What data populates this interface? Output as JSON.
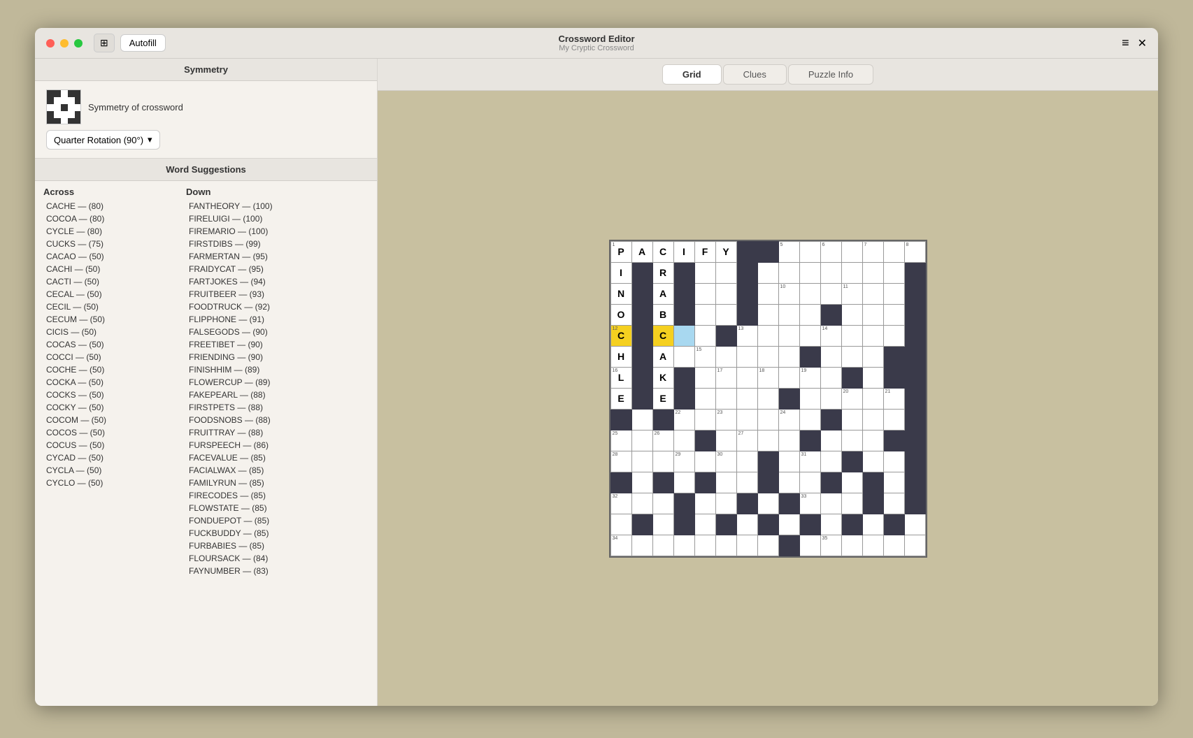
{
  "window": {
    "title": "Crossword Editor",
    "subtitle": "My Cryptic Crossword"
  },
  "titlebar": {
    "sidebar_icon": "⊞",
    "autofill_label": "Autofill",
    "menu_icon": "≡",
    "close_icon": "✕"
  },
  "tabs": [
    {
      "label": "Grid",
      "active": true
    },
    {
      "label": "Clues",
      "active": false
    },
    {
      "label": "Puzzle Info",
      "active": false
    }
  ],
  "sidebar": {
    "symmetry_section_label": "Symmetry",
    "symmetry_of_crossword_label": "Symmetry of crossword",
    "dropdown_label": "Quarter Rotation (90°)",
    "word_suggestions_label": "Word Suggestions",
    "across_label": "Across",
    "down_label": "Down",
    "across_items": [
      "CACHE — (80)",
      "COCOA — (80)",
      "CYCLE — (80)",
      "CUCKS — (75)",
      "CACAO — (50)",
      "CACHI — (50)",
      "CACTI — (50)",
      "CECAL — (50)",
      "CECIL — (50)",
      "CECUM — (50)",
      "CICIS — (50)",
      "COCAS — (50)",
      "COCCI — (50)",
      "COCHE — (50)",
      "COCKA — (50)",
      "COCKS — (50)",
      "COCKY — (50)",
      "COCOM — (50)",
      "COCOS — (50)",
      "COCUS — (50)",
      "CYCAD — (50)",
      "CYCLA — (50)",
      "CYCLO — (50)"
    ],
    "down_items": [
      "FANTHEORY — (100)",
      "FIRELUIGI — (100)",
      "FIREMARIO — (100)",
      "FIRSTDIBS — (99)",
      "FARMERTAN — (95)",
      "FRAIDYCAT — (95)",
      "FARTJOKES — (94)",
      "FRUITBEER — (93)",
      "FOODTRUCK — (92)",
      "FLIPPHONE — (91)",
      "FALSEGODS — (90)",
      "FREETIBET — (90)",
      "FRIENDING — (90)",
      "FINISHHIM — (89)",
      "FLOWERCUP — (89)",
      "FAKEPEARL — (88)",
      "FIRSTPETS — (88)",
      "FOODSNOBS — (88)",
      "FRUITTRAY — (88)",
      "FURSPEECH — (86)",
      "FACEVALUE — (85)",
      "FACIALWAX — (85)",
      "FAMILYRUN — (85)",
      "FIRECODES — (85)",
      "FLOWSTATE — (85)",
      "FONDUEPOT — (85)",
      "FUCKBUDDY — (85)",
      "FURBABIES — (85)",
      "FLOURSACK — (84)",
      "FAYNUMBER — (83)"
    ]
  },
  "grid": {
    "rows": 15,
    "cols": 15
  }
}
